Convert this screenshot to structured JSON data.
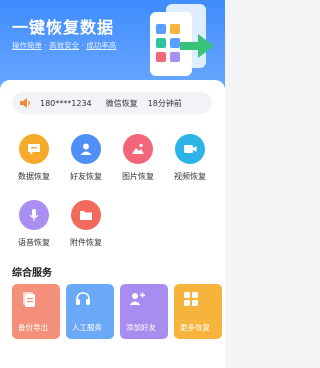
{
  "hero": {
    "title": "一键恢复数据",
    "subtitle_parts": [
      "操作简单",
      "高效安全",
      "成功率高"
    ],
    "subtitle_sep": " · "
  },
  "notice": {
    "icon": "speaker-icon",
    "phone": "180****1234",
    "action": "微信恢复",
    "time": "18分钟前"
  },
  "features": [
    {
      "label": "数据恢复",
      "icon": "chat-bubble-icon",
      "color": "#f7a928"
    },
    {
      "label": "好友恢复",
      "icon": "contact-icon",
      "color": "#4f8ff7"
    },
    {
      "label": "图片恢复",
      "icon": "image-icon",
      "color": "#f2667a"
    },
    {
      "label": "视频恢复",
      "icon": "video-icon",
      "color": "#2cb4e8"
    },
    {
      "label": "语音恢复",
      "icon": "microphone-icon",
      "color": "#a98ff2"
    },
    {
      "label": "附件恢复",
      "icon": "folder-icon",
      "color": "#f26a5e"
    }
  ],
  "services": {
    "title": "综合服务",
    "items": [
      {
        "label": "备份导出",
        "icon": "document-icon",
        "color": "#f48f7a"
      },
      {
        "label": "人工服务",
        "icon": "headset-icon",
        "color": "#6aa8f8"
      },
      {
        "label": "添加好友",
        "icon": "add-user-icon",
        "color": "#a98cf0"
      },
      {
        "label": "更多恢复",
        "icon": "grid-icon",
        "color": "#f7b43c"
      }
    ]
  }
}
